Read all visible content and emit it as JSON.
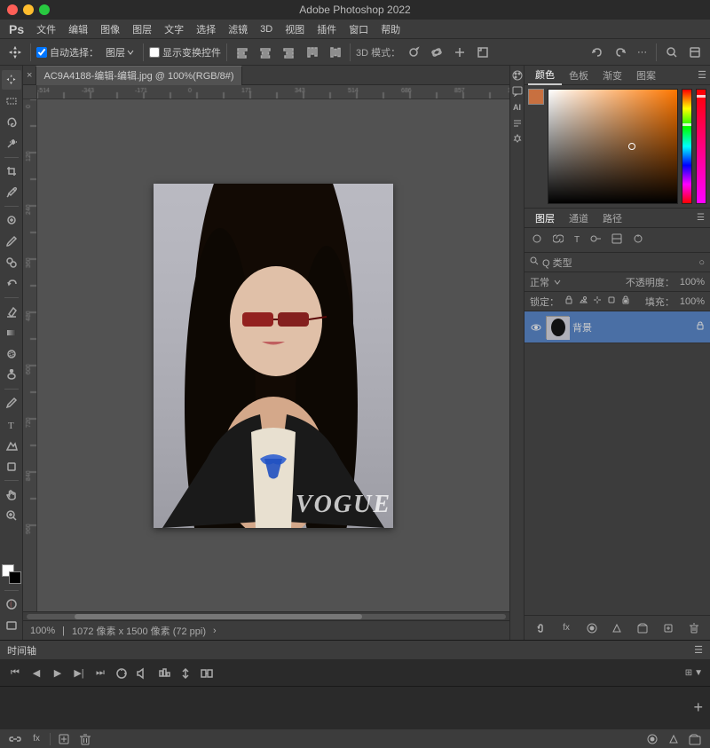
{
  "app": {
    "title": "Adobe Photoshop 2022",
    "tab_label": "AC9A4188-编辑-编辑.jpg @ 100%(RGB/8#)"
  },
  "menu": {
    "items": [
      "Ps",
      "文件",
      "编辑",
      "图像",
      "图层",
      "文字",
      "选择",
      "滤镜",
      "3D",
      "视图",
      "插件",
      "窗口",
      "帮助"
    ]
  },
  "toolbar": {
    "auto_select_label": "自动选择：",
    "layer_label": "图层",
    "show_transform_label": "显示变换控件",
    "mode_3d": "3D 模式：",
    "more_btn": "···"
  },
  "left_tools": {
    "tools": [
      "move",
      "marquee",
      "lasso",
      "magic-wand",
      "crop",
      "eyedropper",
      "heal",
      "brush",
      "clone",
      "history",
      "eraser",
      "gradient",
      "blur",
      "dodge",
      "pen",
      "text",
      "path-select",
      "shape",
      "hand",
      "zoom"
    ]
  },
  "color_panel": {
    "tabs": [
      "颜色",
      "色板",
      "渐变",
      "图案"
    ],
    "active_tab": "颜色"
  },
  "layers_panel": {
    "tabs": [
      "图层",
      "通道",
      "路径"
    ],
    "active_tab": "图层",
    "filter_label": "Q 类型",
    "normal_label": "正常",
    "opacity_label": "不透明度：",
    "lock_label": "锁定：",
    "fill_label": "填充：",
    "layers": [
      {
        "name": "背景",
        "visible": true,
        "selected": true
      }
    ]
  },
  "status_bar": {
    "zoom": "100%",
    "dimensions": "1072 像素 x 1500 像素 (72 ppi)"
  },
  "timeline": {
    "title": "时间轴"
  },
  "bottom_bar": {
    "items": [
      "link",
      "fx",
      "new-layer",
      "trash",
      "mask",
      "adjustment",
      "folder"
    ]
  }
}
